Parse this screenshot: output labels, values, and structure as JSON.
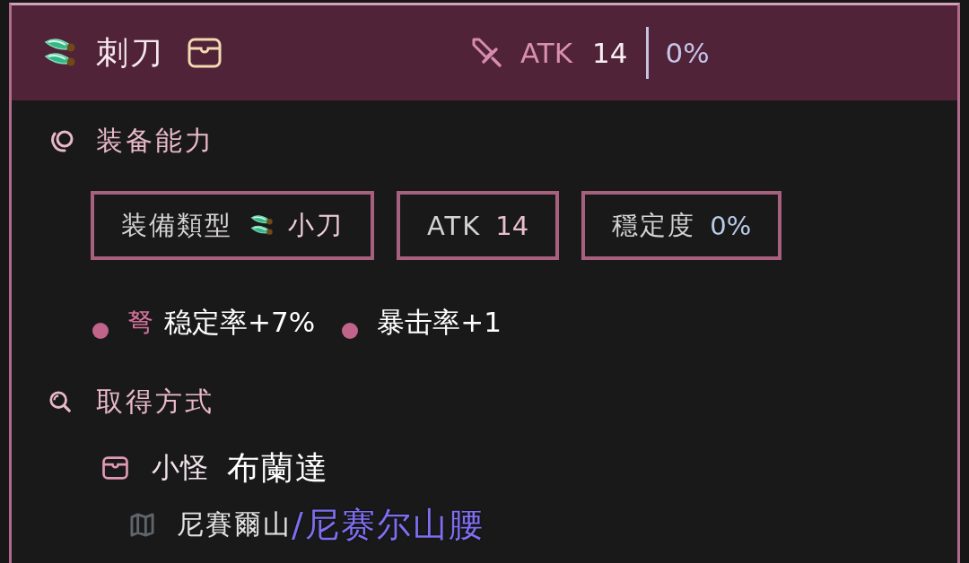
{
  "header": {
    "title": "刺刀",
    "stat_label": "ATK",
    "stat_value": "14",
    "stat_percent": "0%"
  },
  "abilities": {
    "title": "装备能力",
    "stats": [
      {
        "kind": "weapon_type",
        "label": "装備類型",
        "value": "小刀"
      },
      {
        "kind": "attack",
        "label": "ATK",
        "value": "14"
      },
      {
        "kind": "stability",
        "label": "穩定度",
        "value": "0%"
      }
    ],
    "bonuses": [
      {
        "prefix": "弩",
        "text": "稳定率+7%"
      },
      {
        "text": "暴击率+1"
      }
    ]
  },
  "acquisition": {
    "title": "取得方式",
    "sources": [
      {
        "type": "小怪",
        "name": "布蘭達",
        "locations": [
          {
            "name": "尼賽爾山",
            "note": "/尼赛尔山腰"
          }
        ]
      }
    ]
  }
}
